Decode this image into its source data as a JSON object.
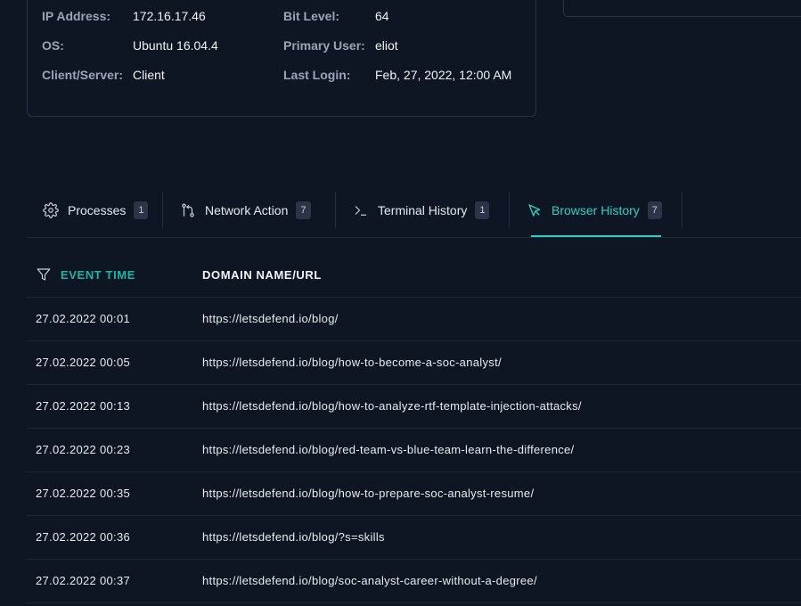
{
  "host_info": {
    "ip_label": "IP Address:",
    "ip_value": "172.16.17.46",
    "os_label": "OS:",
    "os_value": "Ubuntu 16.04.4",
    "client_label": "Client/Server:",
    "client_value": "Client",
    "bit_label": "Bit Level:",
    "bit_value": "64",
    "user_label": "Primary User:",
    "user_value": "eliot",
    "login_label": "Last Login:",
    "login_value": "Feb, 27, 2022, 12:00 AM"
  },
  "tabs": [
    {
      "label": "Processes",
      "count": "1",
      "icon": "gear-icon",
      "active": false
    },
    {
      "label": "Network Action",
      "count": "7",
      "icon": "git-branch-icon",
      "active": false
    },
    {
      "label": "Terminal History",
      "count": "1",
      "icon": "terminal-icon",
      "active": false
    },
    {
      "label": "Browser History",
      "count": "7",
      "icon": "cursor-icon",
      "active": true
    }
  ],
  "table": {
    "headers": {
      "time": "EVENT TIME",
      "domain": "DOMAIN NAME/URL"
    },
    "rows": [
      {
        "time": "27.02.2022 00:01",
        "url": "https://letsdefend.io/blog/"
      },
      {
        "time": "27.02.2022 00:05",
        "url": "https://letsdefend.io/blog/how-to-become-a-soc-analyst/"
      },
      {
        "time": "27.02.2022 00:13",
        "url": "https://letsdefend.io/blog/how-to-analyze-rtf-template-injection-attacks/"
      },
      {
        "time": "27.02.2022 00:23",
        "url": "https://letsdefend.io/blog/red-team-vs-blue-team-learn-the-difference/"
      },
      {
        "time": "27.02.2022 00:35",
        "url": "https://letsdefend.io/blog/how-to-prepare-soc-analyst-resume/"
      },
      {
        "time": "27.02.2022 00:36",
        "url": "https://letsdefend.io/blog/?s=skills"
      },
      {
        "time": "27.02.2022 00:37",
        "url": "https://letsdefend.io/blog/soc-analyst-career-without-a-degree/"
      }
    ]
  },
  "colors": {
    "accent": "#2fd0c4",
    "header_accent": "#1fb3a7",
    "background": "#0f1623"
  }
}
